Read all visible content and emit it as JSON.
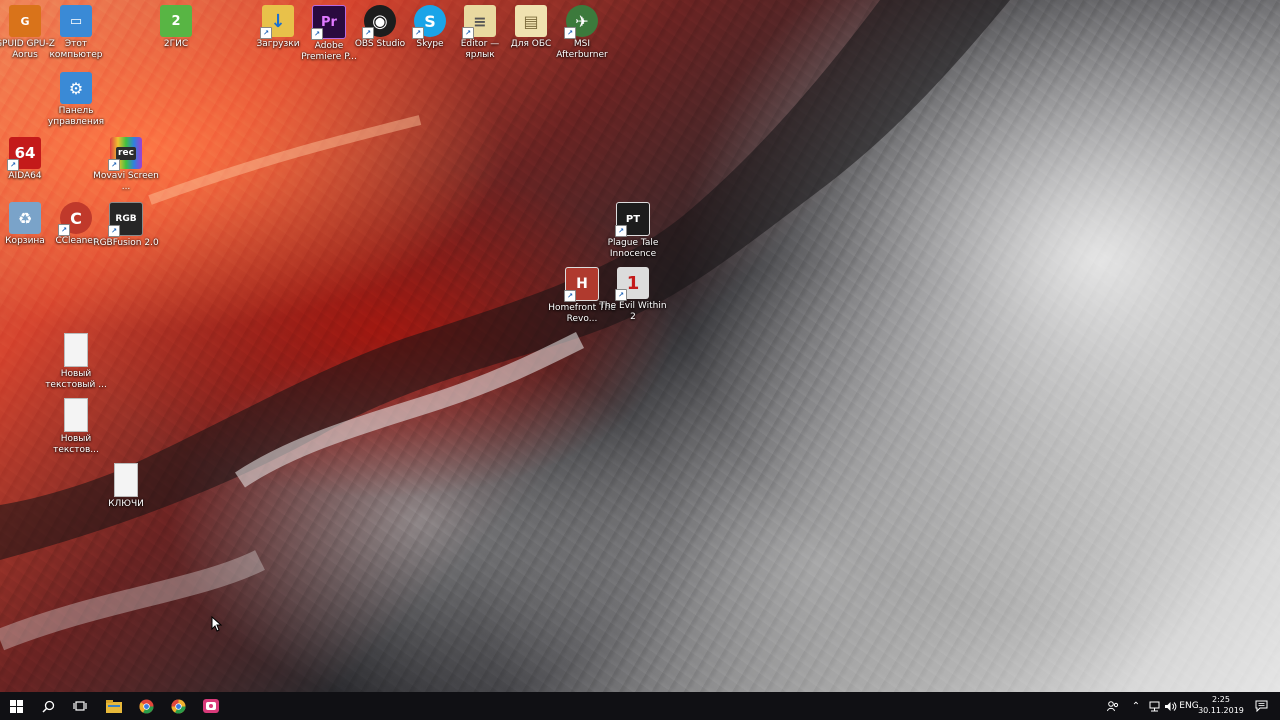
{
  "desktop": {
    "icons": [
      {
        "name": "gpuid-icon",
        "label": "GPUID GPU-Z Aorus",
        "glyph": "G",
        "bg": "#d9731a",
        "shortcut": false
      },
      {
        "name": "this-pc-icon",
        "label": "Этот компьютер",
        "glyph": "▭",
        "bg": "#3a8ad6",
        "shortcut": false
      },
      {
        "name": "2gis-icon",
        "label": "2ГИС",
        "glyph": "2",
        "bg": "#58b544",
        "shortcut": false
      },
      {
        "name": "downloads-icon",
        "label": "Загрузки",
        "glyph": "↓",
        "bg": "#e8c14a",
        "shortcut": true
      },
      {
        "name": "premiere-icon",
        "label": "Adobe Premiere P...",
        "glyph": "Pr",
        "bg": "#2a0a3f",
        "shortcut": true
      },
      {
        "name": "obs-icon",
        "label": "OBS Studio",
        "glyph": "◉",
        "bg": "#1d1d1d",
        "shortcut": true
      },
      {
        "name": "skype-icon",
        "label": "Skype",
        "glyph": "S",
        "bg": "#1aa4e8",
        "shortcut": true
      },
      {
        "name": "editor-icon",
        "label": "Editor — ярлык",
        "glyph": "≡",
        "bg": "#e9d9a0",
        "shortcut": true
      },
      {
        "name": "for-obs-icon",
        "label": "Для ОБС",
        "glyph": "▤",
        "bg": "#f0e2b0",
        "shortcut": false
      },
      {
        "name": "msi-afterburner-icon",
        "label": "MSI Afterburner",
        "glyph": "✈",
        "bg": "#3c7a3c",
        "shortcut": true
      },
      {
        "name": "control-panel-icon",
        "label": "Панель управления",
        "glyph": "⚙",
        "bg": "#3a8ad6",
        "shortcut": false
      },
      {
        "name": "aida64-icon",
        "label": "AIDA64",
        "glyph": "64",
        "bg": "#c41a1a",
        "shortcut": true
      },
      {
        "name": "movavi-icon",
        "label": "Movavi Screen ...",
        "glyph": "rec",
        "bg": "#2c2c2c",
        "shortcut": true
      },
      {
        "name": "recycle-bin-icon",
        "label": "Корзина",
        "glyph": "♻",
        "bg": "#7aa3c9",
        "shortcut": false
      },
      {
        "name": "ccleaner-icon",
        "label": "CCleaner",
        "glyph": "C",
        "bg": "#c0392b",
        "shortcut": true
      },
      {
        "name": "rgbfusion-icon",
        "label": "RGBFusion 2.0",
        "glyph": "RGB",
        "bg": "#262626",
        "shortcut": true
      },
      {
        "name": "plague-tale-icon",
        "label": "Plague Tale Innocence",
        "glyph": "PT",
        "bg": "#1c1c1c",
        "shortcut": true
      },
      {
        "name": "homefront-icon",
        "label": "Homefront The Revo...",
        "glyph": "H",
        "bg": "#b03a2e",
        "shortcut": true
      },
      {
        "name": "evil-within-icon",
        "label": "The Evil Within 2",
        "glyph": "1",
        "bg": "#dcdcdc",
        "shortcut": true
      },
      {
        "name": "text-file-1-icon",
        "label": "Новый текстовый ...",
        "glyph": "",
        "bg": "#f4f4f4",
        "shortcut": false
      },
      {
        "name": "text-file-2-icon",
        "label": "Новый текстов...",
        "glyph": "",
        "bg": "#f4f4f4",
        "shortcut": false
      },
      {
        "name": "keys-file-icon",
        "label": "КЛЮЧИ",
        "glyph": "",
        "bg": "#f4f4f4",
        "shortcut": false
      }
    ]
  },
  "taskbar": {
    "start": "start-icon",
    "search": "search-icon",
    "task_view": "task-view-icon",
    "pinned": [
      {
        "name": "file-explorer-taskbar-icon",
        "color": "#e8b93a"
      },
      {
        "name": "chrome-taskbar-icon-1",
        "color": "#e2463b"
      },
      {
        "name": "chrome-taskbar-icon-2",
        "color": "#f2b02e"
      },
      {
        "name": "movavi-taskbar-icon",
        "color": "#d93a7a"
      }
    ],
    "tray": {
      "language": "ENG",
      "time": "2:25",
      "date": "30.11.2019"
    }
  }
}
